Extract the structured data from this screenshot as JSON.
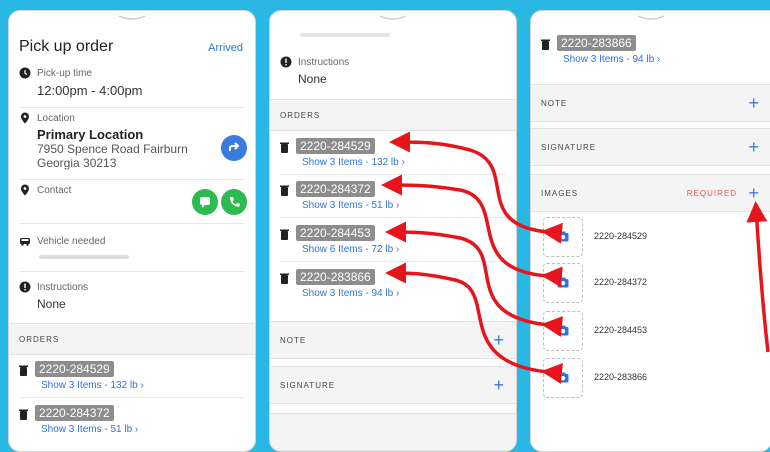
{
  "panel1": {
    "title": "Pick up order",
    "status": "Arrived",
    "pickup_label": "Pick-up time",
    "pickup_value": "12:00pm - 4:00pm",
    "location_label": "Location",
    "location_name": "Primary Location",
    "location_address1": "7950 Spence Road Fairburn",
    "location_address2": "Georgia 30213",
    "contact_label": "Contact",
    "vehicle_label": "Vehicle needed",
    "instructions_label": "Instructions",
    "instructions_value": "None",
    "orders_header": "ORDERS",
    "orders": [
      {
        "id": "2220-284529",
        "items": "Show 3 Items - 132 lb ›"
      },
      {
        "id": "2220-284372",
        "items": "Show 3 Items - 51 lb ›"
      }
    ]
  },
  "panel2": {
    "instructions_label": "Instructions",
    "instructions_value": "None",
    "orders_header": "ORDERS",
    "orders": [
      {
        "id": "2220-284529",
        "items": "Show 3 Items - 132 lb ›"
      },
      {
        "id": "2220-284372",
        "items": "Show 3 Items - 51 lb ›"
      },
      {
        "id": "2220-284453",
        "items": "Show 6 Items - 72 lb ›"
      },
      {
        "id": "2220-283866",
        "items": "Show 3 Items - 94 lb ›"
      }
    ],
    "note_header": "NOTE",
    "signature_header": "SIGNATURE",
    "add_symbol": "+"
  },
  "panel3": {
    "order": {
      "id": "2220-283866",
      "items": "Show 3 Items - 94 lb ›"
    },
    "note_header": "NOTE",
    "signature_header": "SIGNATURE",
    "images_header": "IMAGES",
    "required_label": "REQUIRED",
    "add_symbol": "+",
    "images": [
      "2220-284529",
      "2220-284372",
      "2220-284453",
      "2220-283866"
    ]
  },
  "colors": {
    "background": "#29b7e3",
    "accent": "#3a7be0",
    "arrow": "#e8141b",
    "required": "#e05a4a",
    "contact_button": "#2dbb4f",
    "navigate_button": "#3a7be0"
  }
}
